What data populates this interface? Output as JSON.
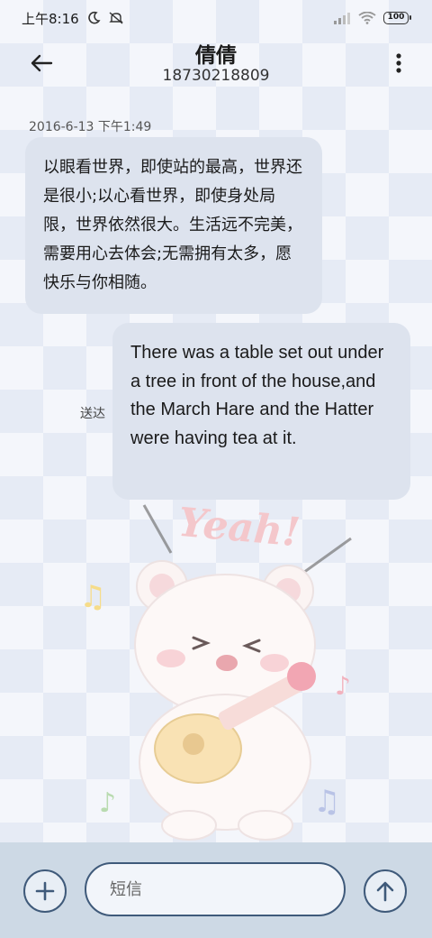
{
  "status_bar": {
    "time": "上午8:16",
    "battery": "100"
  },
  "header": {
    "contact_name": "倩倩",
    "contact_number": "18730218809"
  },
  "conversation": {
    "timestamp": "2016-6-13 下午1:49",
    "incoming_message": "以眼看世界，即使站的最高，世界还是很小;以心看世界，即使身处局限，世界依然很大。生活远不完美，需要用心去体会;无需拥有太多，愿快乐与你相随。",
    "outgoing_message": "There was a table set out under a tree in front of the house,and the March Hare and the Hatter were having tea at it.",
    "delivery_status": "送达"
  },
  "sticker": {
    "text": "Yeah!"
  },
  "composer": {
    "placeholder": "短信"
  },
  "icons": [
    "moon-icon",
    "mute-icon",
    "signal-icon",
    "wifi-icon",
    "battery-icon",
    "back-arrow-icon",
    "more-vert-icon",
    "plus-icon",
    "send-arrow-icon"
  ],
  "colors": {
    "bubble": "#dde3ee",
    "composer_bar": "#cdd9e5",
    "button_outline": "#3f5a7a"
  }
}
